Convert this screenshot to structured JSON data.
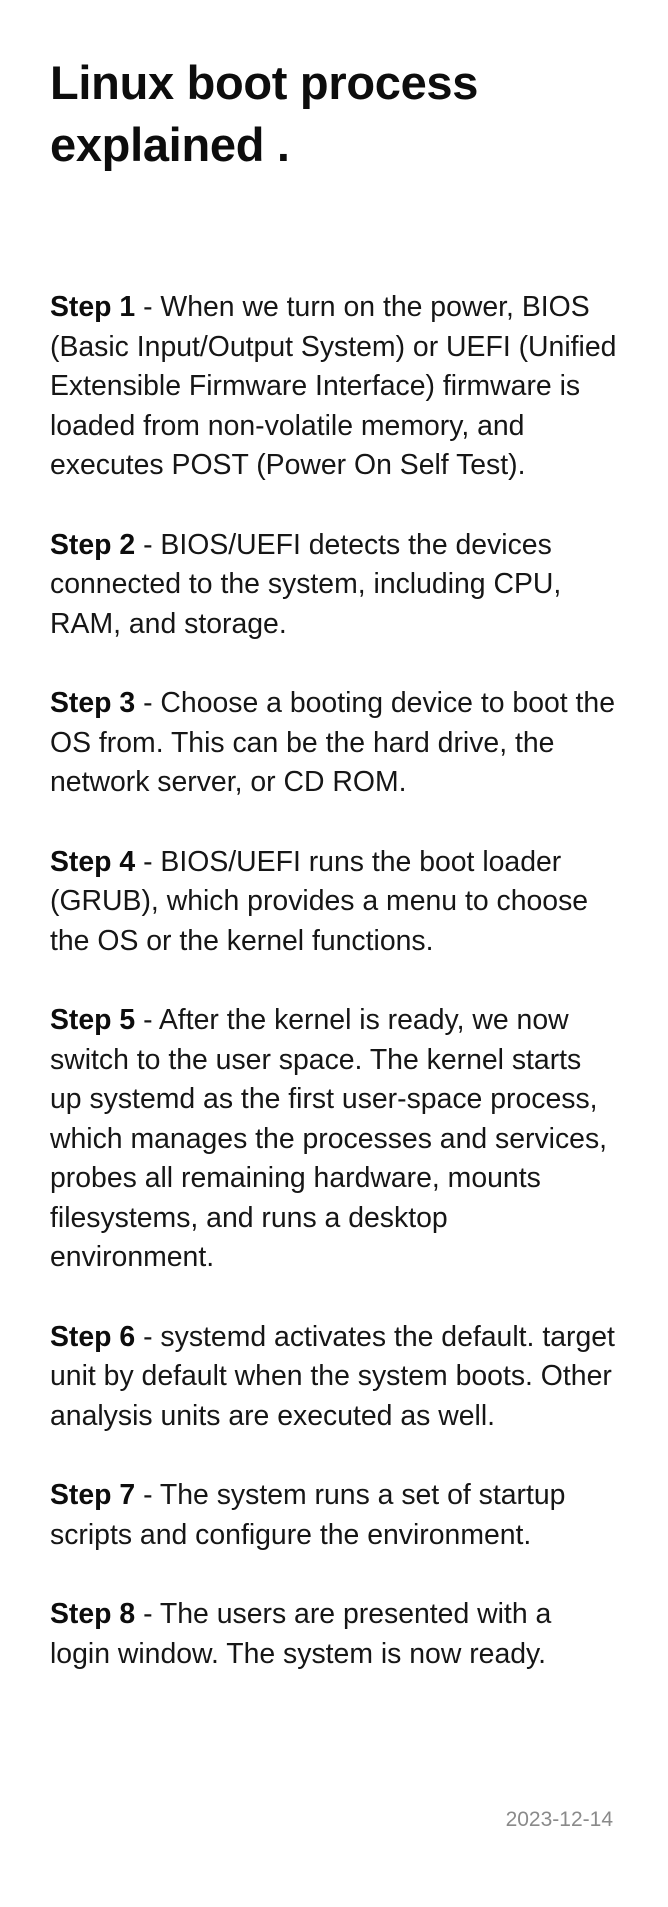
{
  "title": "Linux boot process explained .",
  "steps": [
    {
      "label": "Step 1",
      "text": " - When we turn on the power, BIOS (Basic Input/Output System) or UEFI (Unified Extensible Firmware Interface) firmware is loaded from non-volatile memory, and executes POST (Power On Self Test)."
    },
    {
      "label": "Step 2",
      "text": " - BIOS/UEFI detects the devices connected to the system, including CPU, RAM, and storage."
    },
    {
      "label": "Step 3",
      "text": " - Choose a booting device to boot the OS from. This can be the hard drive, the network server, or CD ROM."
    },
    {
      "label": "Step 4",
      "text": " - BIOS/UEFI runs the boot loader (GRUB), which provides a menu to choose the OS or the kernel functions."
    },
    {
      "label": "Step 5",
      "text": " - After the kernel is ready, we now switch to the user space. The kernel starts up systemd as the first user-space process, which manages the processes and services, probes all remaining hardware, mounts filesystems, and runs a desktop environment."
    },
    {
      "label": "Step 6",
      "text": " - systemd activates the default. target unit by default when the system boots. Other analysis units are executed as well."
    },
    {
      "label": "Step 7",
      "text": " - The system runs a set of startup scripts and configure the environment."
    },
    {
      "label": "Step 8",
      "text": " - The users are presented with a login window. The system is now ready."
    }
  ],
  "date": "2023-12-14"
}
